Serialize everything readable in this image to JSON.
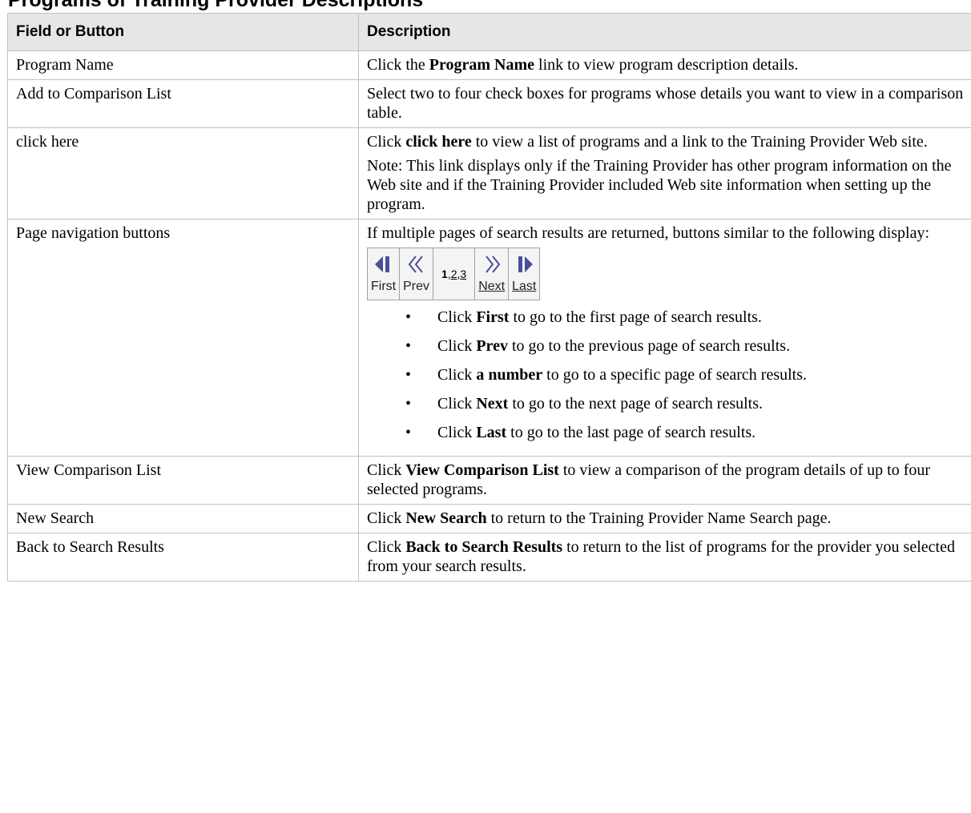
{
  "page": {
    "heading": "Programs of Training Provider Descriptions"
  },
  "table": {
    "headers": [
      "Field or Button",
      "Description"
    ],
    "rows": [
      {
        "field": "Program Name",
        "pre": "Click the ",
        "bold": "Program Name",
        "post": " link to view program description details."
      },
      {
        "field": "Add to Comparison List",
        "text": "Select two to four check boxes for programs whose details you want to view in a comparison table."
      },
      {
        "field": "click here",
        "pre": "Click ",
        "bold": "click here",
        "post": " to view a list of programs and a link to the Training Provider Web site.",
        "note": "Note: This link displays only if the Training Provider has other program information on the Web site and if the Training Provider included Web site information when setting up the program."
      },
      {
        "field": "Page navigation buttons",
        "text": "If multiple pages of search results are returned, buttons similar to the following display:",
        "nav": {
          "first": "First",
          "prev": "Prev",
          "next": "Next",
          "last": "Last",
          "current_page": "1",
          "sep": ", ",
          "page2": "2",
          "page3": "3"
        },
        "bullets": [
          {
            "pre": "Click ",
            "bold": "First",
            "post": " to go to the first page of search results."
          },
          {
            "pre": "Click ",
            "bold": "Prev",
            "post": " to go to the previous page of search results."
          },
          {
            "pre": "Click ",
            "bold": "a number",
            "post": " to go to a specific page of search results."
          },
          {
            "pre": "Click ",
            "bold": "Next",
            "post": " to go to the next page of search results."
          },
          {
            "pre": "Click ",
            "bold": "Last",
            "post": " to go to the last page of search results."
          }
        ]
      },
      {
        "field": "View Comparison List",
        "pre": "Click ",
        "bold": "View Comparison List",
        "post": " to view a comparison of the program details of up to four selected programs."
      },
      {
        "field": "New Search",
        "pre": "Click ",
        "bold": "New Search",
        "post": " to return to the Training Provider Name Search page."
      },
      {
        "field": "Back to Search Results",
        "pre": "Click ",
        "bold": "Back to Search Results",
        "post": " to return to the list of programs for the provider you selected from your search results."
      }
    ]
  },
  "colors": {
    "header_bg": "#e6e6e6",
    "border": "#c0c0c0",
    "icon": "#4a4f9a"
  },
  "icons": [
    "first-icon",
    "prev-icon",
    "next-icon",
    "last-icon"
  ]
}
